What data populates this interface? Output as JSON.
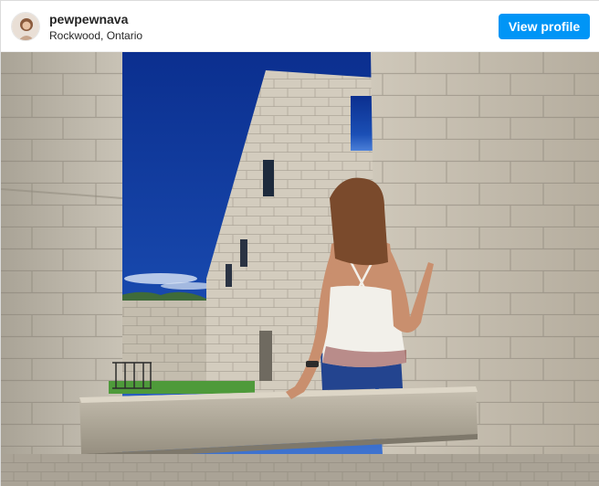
{
  "header": {
    "username": "pewpewnava",
    "location": "Rockwood, Ontario",
    "view_profile_label": "View profile"
  },
  "photo": {
    "alt": "Woman in a white top sitting on a stone ledge inside old stone ruins under a deep blue sky"
  },
  "colors": {
    "accent": "#0095f6",
    "sky": "#1b4fb5",
    "stone": "#b9b3a6"
  }
}
